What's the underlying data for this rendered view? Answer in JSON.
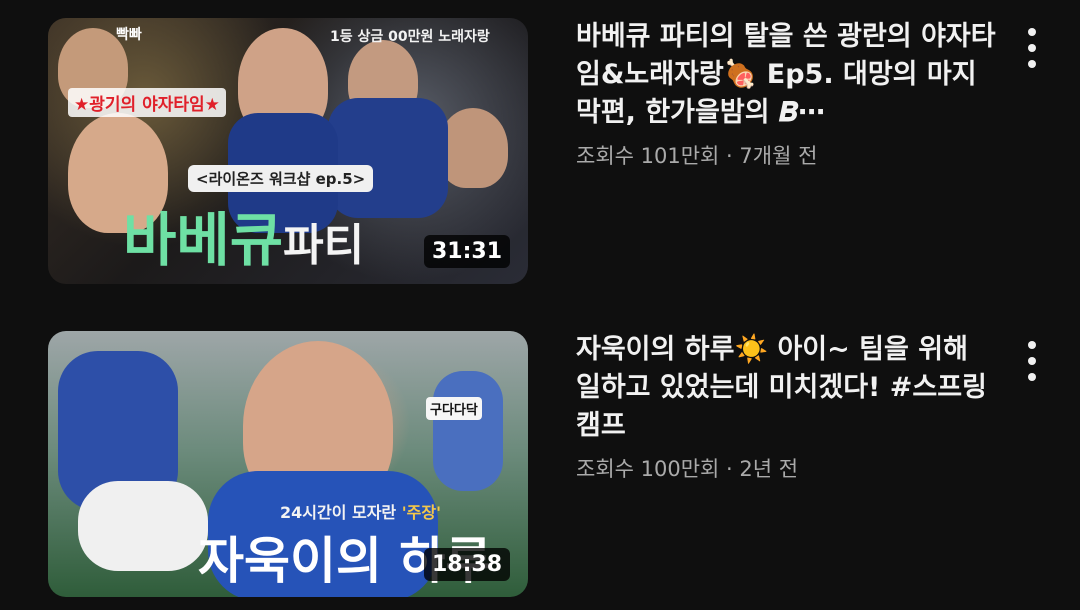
{
  "videos": [
    {
      "title": "바베큐 파티의 탈을 쓴 광란의 야자타임&노래자랑🍖 Ep5. 대망의 마지막편, 한가을밤의 𝑩⋯",
      "views": "조회수 101만회",
      "age": "7개월 전",
      "duration": "31:31",
      "thumb_text": {
        "top_right": "1등 상금 00만원 노래자랑",
        "badge": "빡빠",
        "red_tag": "★광기의 야자타임★",
        "series": "<라이온즈 워크샵 ep.5>",
        "big_left": "바베큐",
        "big_right": "파티"
      }
    },
    {
      "title": "자욱이의 하루☀️ 아이~ 팀을 위해 일하고 있었는데 미치겠다! #스프링캠프",
      "views": "조회수 100만회",
      "age": "2년 전",
      "duration": "18:38",
      "thumb_text": {
        "sticker": "구다다닥",
        "subtitle_pre": "24시간이 모자란 ",
        "subtitle_hl": "'주장'",
        "big": "자욱이의 하루"
      }
    }
  ],
  "separator": " · ",
  "icons": {
    "menu": "more-vert-icon"
  },
  "colors": {
    "background": "#0f0f0f",
    "title": "#f1f1f1",
    "subtext": "#aaaaaa",
    "thumb_green": "#6ee0a4",
    "thumb_red": "#e0202a"
  }
}
